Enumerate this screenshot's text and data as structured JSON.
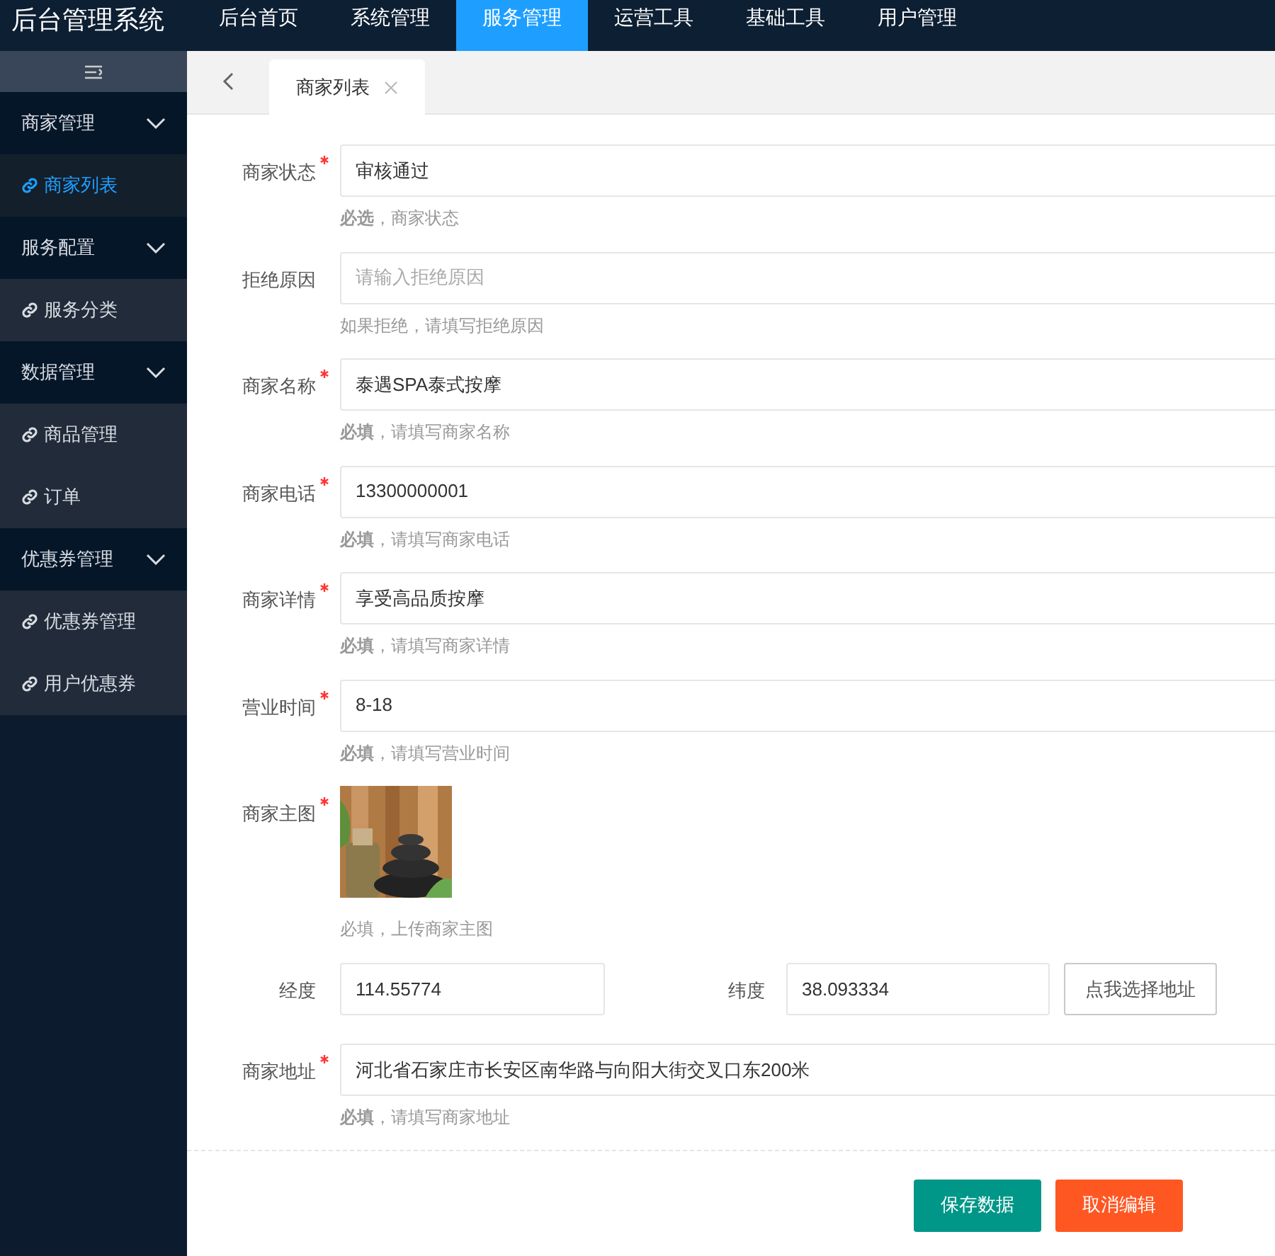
{
  "app_title": "后台管理系统",
  "top_nav": [
    {
      "label": "后台首页",
      "selected": false
    },
    {
      "label": "系统管理",
      "selected": false
    },
    {
      "label": "服务管理",
      "selected": true
    },
    {
      "label": "运营工具",
      "selected": false
    },
    {
      "label": "基础工具",
      "selected": false
    },
    {
      "label": "用户管理",
      "selected": false
    }
  ],
  "sidebar": {
    "groups": [
      {
        "label": "商家管理",
        "expanded": true,
        "children": [
          {
            "label": "商家列表",
            "selected": true
          }
        ]
      },
      {
        "label": "服务配置",
        "expanded": true,
        "children": [
          {
            "label": "服务分类",
            "selected": false
          }
        ]
      },
      {
        "label": "数据管理",
        "expanded": true,
        "children": [
          {
            "label": "商品管理",
            "selected": false
          },
          {
            "label": "订单",
            "selected": false
          }
        ]
      },
      {
        "label": "优惠券管理",
        "expanded": true,
        "children": [
          {
            "label": "优惠券管理",
            "selected": false
          },
          {
            "label": "用户优惠券",
            "selected": false
          }
        ]
      }
    ]
  },
  "tabs": [
    {
      "label": "商家列表",
      "selected": true
    }
  ],
  "form": {
    "fields": [
      {
        "kind": "input",
        "label": "商家状态",
        "required": true,
        "value": "审核通过",
        "hint": "**必选**，商家状态"
      },
      {
        "kind": "input",
        "label": "拒绝原因",
        "required": false,
        "placeholder": "请输入拒绝原因",
        "hint": "如果拒绝，请填写拒绝原因"
      },
      {
        "kind": "input",
        "label": "商家名称",
        "required": true,
        "value": "泰遇SPA泰式按摩",
        "hint": "**必填**，请填写商家名称"
      },
      {
        "kind": "input",
        "label": "商家电话",
        "required": true,
        "value": "13300000001",
        "hint": "**必填**，请填写商家电话"
      },
      {
        "kind": "input",
        "label": "商家详情",
        "required": true,
        "value": "享受高品质按摩",
        "hint": "**必填**，请填写商家详情"
      },
      {
        "kind": "input",
        "label": "营业时间",
        "required": true,
        "value": "8-18",
        "hint": "**必填**，请填写营业时间"
      },
      {
        "label": "商家主图",
        "required": true,
        "hint": "必填，上传商家主图"
      },
      {
        "kind": "coords",
        "label": "经度",
        "value": "114.55774",
        "label_2": "纬度",
        "value_2": "38.093334",
        "button": "点我选择地址"
      },
      {
        "kind": "input",
        "label": "商家地址",
        "required": true,
        "value": "河北省石家庄市长安区南华路与向阳大街交叉口东200米",
        "hint": "**必填**，请填写商家地址"
      }
    ],
    "buttons": [
      {
        "kind": "primary",
        "label": "保存数据"
      },
      {
        "kind": "danger",
        "label": "取消编辑"
      }
    ]
  }
}
